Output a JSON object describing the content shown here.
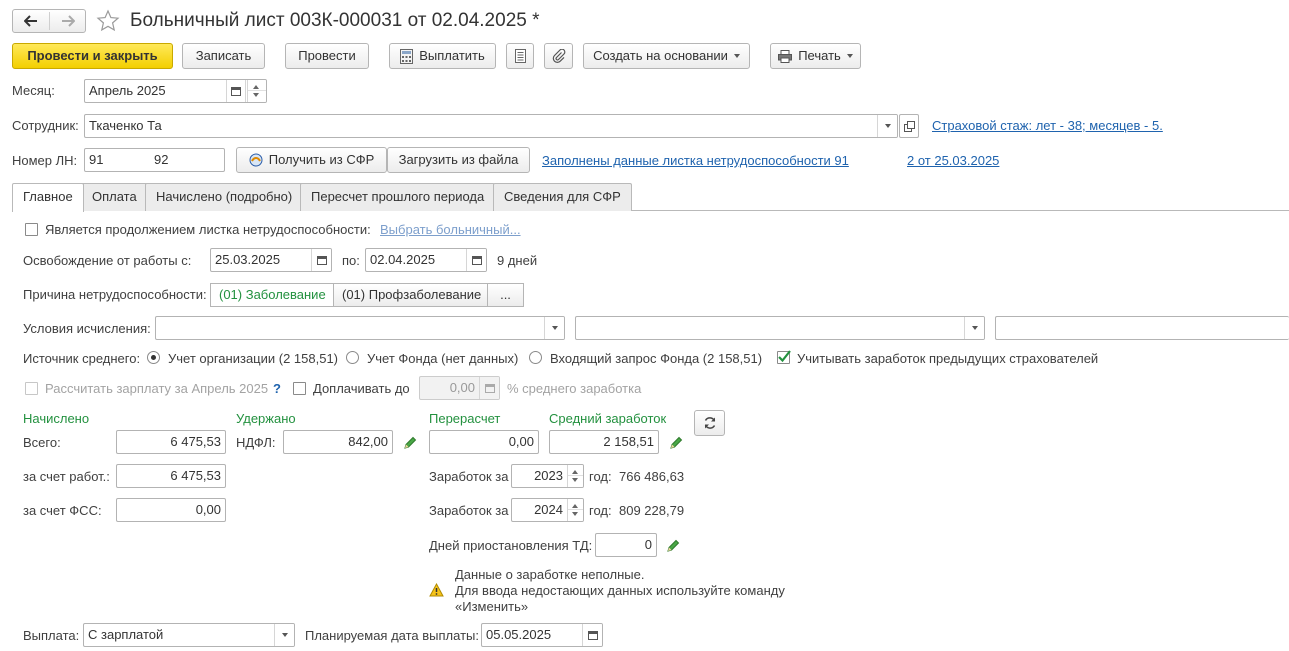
{
  "window": {
    "title": "Больничный лист 003К-000031 от 02.04.2025 *"
  },
  "toolbar": {
    "post_close": "Провести и закрыть",
    "save": "Записать",
    "post": "Провести",
    "pay": "Выплатить",
    "create_based": "Создать на основании",
    "print": "Печать"
  },
  "header": {
    "month_label": "Месяц:",
    "month_value": "Апрель 2025",
    "employee_label": "Сотрудник:",
    "employee_value": "Ткаченко Та",
    "insurance_link": "Страховой стаж: лет - 38; месяцев - 5.",
    "ln_label": "Номер ЛН:",
    "ln_value": "91              92",
    "get_sfr": "Получить из СФР",
    "load_file": "Загрузить из файла",
    "filled_link": "Заполнены данные листка нетрудоспособности 91",
    "filled_link_tail": "2 от 25.03.2025"
  },
  "tabs": [
    "Главное",
    "Оплата",
    "Начислено (подробно)",
    "Пересчет прошлого периода",
    "Сведения для СФР"
  ],
  "main": {
    "continuation_label": "Является продолжением листка нетрудоспособности:",
    "choose_sick_link": "Выбрать больничный...",
    "release_label": "Освобождение от работы с:",
    "date_from": "25.03.2025",
    "to_label": "по:",
    "date_to": "02.04.2025",
    "days": "9 дней",
    "reason_label": "Причина нетрудоспособности:",
    "reason_1": "(01) Заболевание",
    "reason_2": "(01) Профзаболевание",
    "reason_more": "...",
    "conditions_label": "Условия исчисления:",
    "source_label": "Источник среднего:",
    "source_org": "Учет организации (2 158,51)",
    "source_fund": "Учет Фонда (нет данных)",
    "source_request": "Входящий запрос Фонда (2 158,51)",
    "prev_insurers": "Учитывать заработок предыдущих страхователей",
    "calc_salary": "Рассчитать зарплату за Апрель 2025",
    "calc_help": "?",
    "extra_pay": "Доплачивать до",
    "extra_value": "0,00",
    "avg_percent": "% среднего заработка"
  },
  "totals": {
    "accrued_head": "Начислено",
    "withheld_head": "Удержано",
    "recalc_head": "Перерасчет",
    "avg_head": "Средний заработок",
    "total_label": "Всего:",
    "total_value": "6 475,53",
    "ndfl_label": "НДФЛ:",
    "ndfl_value": "842,00",
    "recalc_value": "0,00",
    "avg_value": "2 158,51",
    "employer_label": "за счет работ.:",
    "employer_value": "6 475,53",
    "fss_label": "за счет ФСС:",
    "fss_value": "0,00",
    "earn_label": "Заработок за",
    "year1": "2023",
    "year_word": "год:",
    "earn1": "766 486,63",
    "year2": "2024",
    "earn2": "809 228,79",
    "suspend_label": "Дней приостановления ТД:",
    "suspend_value": "0",
    "warn_1": "Данные о заработке неполные.",
    "warn_2": "Для ввода недостающих данных используйте команду",
    "warn_3": "«Изменить»"
  },
  "footer": {
    "payout_label": "Выплата:",
    "payout_value": "С зарплатой",
    "planned_label": "Планируемая дата выплаты:",
    "planned_value": "05.05.2025"
  }
}
